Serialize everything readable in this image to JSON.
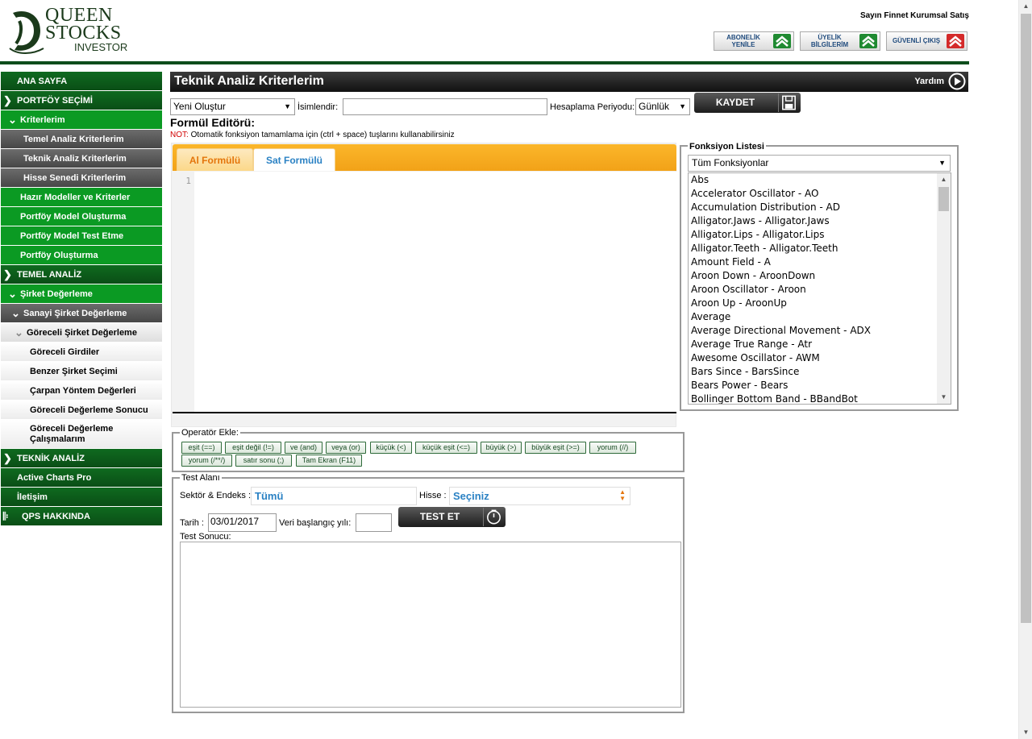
{
  "header": {
    "logo": {
      "line1": "QUEEN",
      "line2": "STOCKS",
      "line3": "INVESTOR"
    },
    "greeting": "Sayın Finnet Kurumsal Satış",
    "buttons": [
      {
        "label_l1": "ABONELİK",
        "label_l2": "YENİLE",
        "icon": "double-chevron-up-green-icon"
      },
      {
        "label_l1": "ÜYELİK",
        "label_l2": "BİLGİLERİM",
        "icon": "double-chevron-up-green-icon"
      },
      {
        "label_l1": "GÜVENLİ ÇIKIŞ",
        "label_l2": "",
        "icon": "double-chevron-up-red-icon"
      }
    ]
  },
  "sidebar": {
    "items": [
      {
        "label": "ANA SAYFA"
      },
      {
        "label": "PORTFÖY SEÇİMİ"
      },
      {
        "label": "Kriterlerim"
      },
      {
        "label": "Temel Analiz Kriterlerim"
      },
      {
        "label": "Teknik Analiz Kriterlerim"
      },
      {
        "label": "Hisse Senedi Kriterlerim"
      },
      {
        "label": "Hazır Modeller ve Kriterler"
      },
      {
        "label": "Portföy Model Oluşturma"
      },
      {
        "label": "Portföy Model Test Etme"
      },
      {
        "label": "Portföy Oluşturma"
      },
      {
        "label": "TEMEL ANALİZ"
      },
      {
        "label": "Şirket Değerleme"
      },
      {
        "label": "Sanayi Şirket Değerleme"
      },
      {
        "label": "Göreceli Şirket Değerleme"
      },
      {
        "label": "Göreceli Girdiler"
      },
      {
        "label": "Benzer Şirket Seçimi"
      },
      {
        "label": "Çarpan Yöntem Değerleri"
      },
      {
        "label": "Göreceli Değerleme Sonucu"
      },
      {
        "label": "Göreceli Değerleme",
        "label2": "Çalışmalarım"
      },
      {
        "label": "TEKNİK ANALİZ"
      },
      {
        "label": "Active Charts Pro"
      },
      {
        "label": "İletişim"
      },
      {
        "label": "QPS HAKKINDA"
      }
    ]
  },
  "main": {
    "title": "Teknik Analiz Kriterlerim",
    "help": "Yardım",
    "criteria_select": "Yeni Oluştur",
    "name_label": "İsimlendir:",
    "name_value": "",
    "period_label": "Hesaplama Periyodu:",
    "period_value": "Günlük",
    "save_label": "KAYDET",
    "editor_title": "Formül Editörü:",
    "note_prefix": "NOT:",
    "note_text": "Otomatik fonksiyon tamamlama için (ctrl + space) tuşlarını kullanabilirsiniz",
    "tabs": [
      {
        "label": "Al Formülü"
      },
      {
        "label": "Sat Formülü"
      }
    ],
    "line_number": "1"
  },
  "functions": {
    "legend": "Fonksiyon Listesi",
    "filter": "Tüm Fonksiyonlar",
    "items": [
      "Abs",
      "Accelerator Oscillator - AO",
      "Accumulation Distribution - AD",
      "Alligator.Jaws - Alligator.Jaws",
      "Alligator.Lips - Alligator.Lips",
      "Alligator.Teeth - Alligator.Teeth",
      "Amount Field - A",
      "Aroon Down - AroonDown",
      "Aroon Oscillator - Aroon",
      "Aroon Up - AroonUp",
      "Average",
      "Average Directional Movement - ADX",
      "Average True Range - Atr",
      "Awesome Oscillator - AWM",
      "Bars Since - BarsSince",
      "Bears Power - Bears",
      "Bollinger Bottom Band - BBandBot"
    ]
  },
  "operators": {
    "legend": "Operatör Ekle:",
    "items": [
      "eşit (==)",
      "eşit değil (!=)",
      "ve (and)",
      "veya (or)",
      "küçük (<)",
      "küçük eşit (<=)",
      "büyük (>)",
      "büyük eşit (>=)",
      "yorum (//)",
      "yorum (/**/)",
      "satır sonu (;)",
      "Tam Ekran (F11)"
    ]
  },
  "test": {
    "legend": "Test Alanı",
    "sector_label": "Sektör & Endeks :",
    "sector_value": "Tümü",
    "stock_label": "Hisse :",
    "stock_value": "Seçiniz",
    "date_label": "Tarih :",
    "date_value": "03/01/2017",
    "start_year_label": "Veri başlangıç yılı:",
    "start_year_value": "",
    "test_button": "TEST ET",
    "result_label": "Test Sonucu:"
  }
}
